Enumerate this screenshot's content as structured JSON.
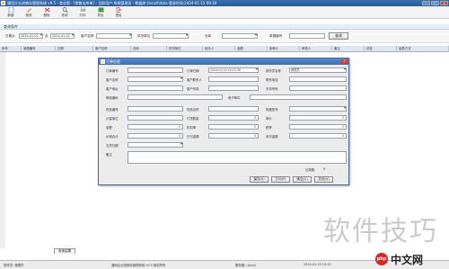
{
  "window": {
    "title": "通用企业进销存管理系统 v9.5 - 商业版 - [销售出库单] - 当前用户:系统管理员 - 数据库:(local)\\data  登录时间:2024-01-15 09:30"
  },
  "toolbar": {
    "buttons": [
      {
        "label": "新增"
      },
      {
        "label": "修改"
      },
      {
        "label": "删除"
      },
      {
        "label": "查询"
      },
      {
        "label": "打印"
      },
      {
        "label": "导出"
      },
      {
        "label": "退出"
      }
    ]
  },
  "panel": {
    "title": "查询条件"
  },
  "filter": {
    "date_label": "日期从",
    "date_from": "2024-01-01",
    "date_to_label": "至",
    "date_to": "2024-01-15",
    "customer_label": "客户名称",
    "customer_value": "",
    "unit_label": "供货单位",
    "unit_value": "",
    "warehouse_label": "仓库",
    "warehouse_value": "",
    "code_label": "单据编号",
    "code_value": "",
    "query_label": "查询"
  },
  "grid": {
    "columns": [
      "序号",
      "单据编号",
      "日期",
      "客户名称",
      "仓库",
      "供货单位",
      "经手人",
      "金额",
      "制单人",
      "审核人",
      "备注",
      "状态",
      "结算方式"
    ]
  },
  "dialog": {
    "title": "订单信息",
    "fields": {
      "order_no_label": "订单编号",
      "order_no": "",
      "date_label": "订单日期",
      "date": "2024-01-15 10:15:36",
      "warehouse_label": "操作员名称",
      "warehouse": "管理员",
      "customer_label": "客户名称",
      "customer": "",
      "contact_label": "客户联系人",
      "contact": "",
      "tel_label": "联系电话",
      "tel": "",
      "addr_label": "客户地址",
      "addr": "",
      "fax_label": "客户传真",
      "fax": "",
      "mobile_label": "手机号码",
      "mobile": "",
      "postal_label": "邮政编码",
      "postal": "",
      "email_label": "电子邮件",
      "email": "",
      "goods_code_label": "货品编号",
      "goods_code": "",
      "goods_name_label": "货品名称",
      "goods_name": "",
      "spec_label": "规格型号",
      "spec": "",
      "unit_label": "计量单位",
      "unit": "",
      "qty_label": "订货数量",
      "qty": "0",
      "price_label": "单价",
      "price": "0",
      "amount_label": "金额",
      "amount": "0",
      "discount_label": "折扣率",
      "discount": "0",
      "tax_label": "税率",
      "tax": "0",
      "total_label": "价税合计",
      "total": "0",
      "deliver_label": "交货日期",
      "deliver": "",
      "paid_label": "已付金额",
      "paid": "0",
      "unpaid_label": "未付金额",
      "unpaid": "0",
      "remark_label": "备注",
      "remark": "",
      "count_label": "记录数:",
      "count": "0"
    },
    "buttons": {
      "save": "保存(S)",
      "print": "打印(P)",
      "clear": "清空(C)",
      "close": "关闭(X)"
    }
  },
  "bottom_tab": "查询结果",
  "status": {
    "s1": "操作员: 管理员",
    "s2": "通用企业进销存管理系统 v9.5 版权所有",
    "s3": "服务器: (local)",
    "s4": "2024-01-15 10:15"
  },
  "watermark": "软件技巧",
  "logo": {
    "badge": "php",
    "text": "中文网"
  }
}
